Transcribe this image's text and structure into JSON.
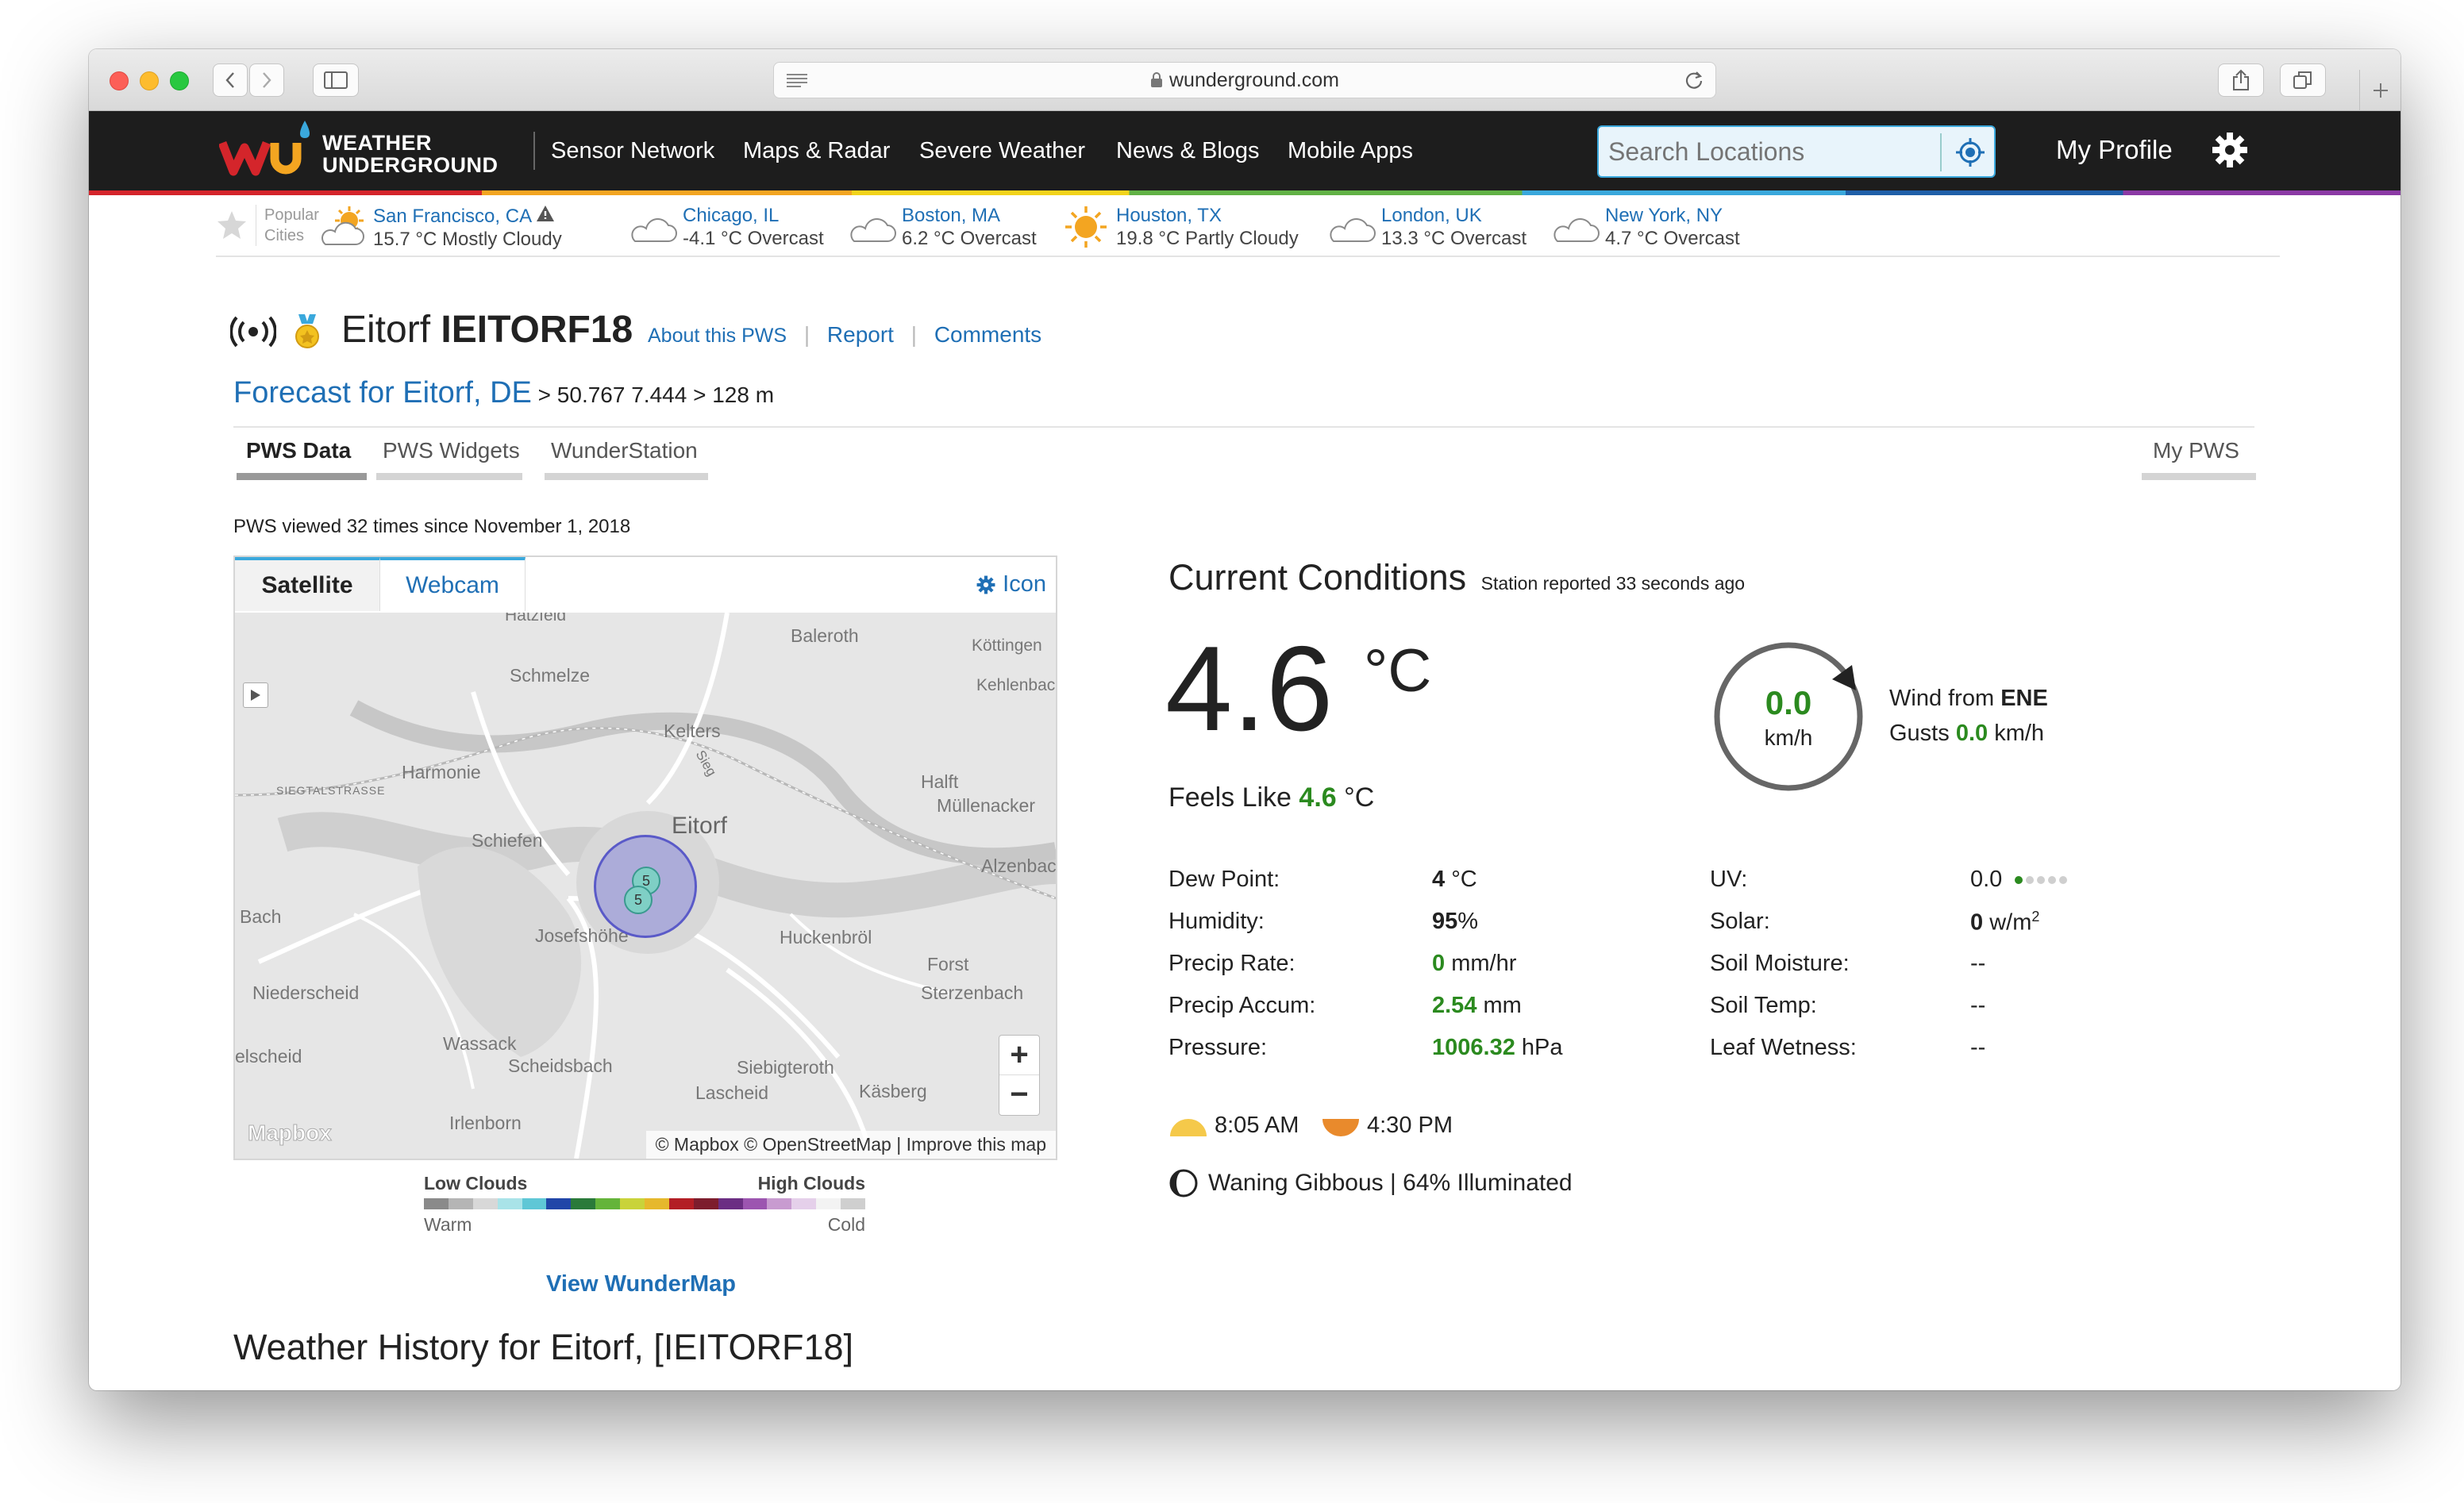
{
  "browser": {
    "url": "wunderground.com"
  },
  "site": {
    "logo_text_line1": "WEATHER",
    "logo_text_line2": "UNDERGROUND",
    "nav": [
      "Sensor Network",
      "Maps & Radar",
      "Severe Weather",
      "News & Blogs",
      "Mobile Apps"
    ],
    "search_placeholder": "Search Locations",
    "profile": "My Profile"
  },
  "popular_cities": {
    "label_line1": "Popular",
    "label_line2": "Cities",
    "items": [
      {
        "name": "San Francisco, CA",
        "weather": "15.7 °C Mostly Cloudy",
        "icon": "partly-cloudy-icon",
        "alert": true
      },
      {
        "name": "Chicago, IL",
        "weather": "-4.1 °C Overcast",
        "icon": "cloud-icon"
      },
      {
        "name": "Boston, MA",
        "weather": "6.2 °C Overcast",
        "icon": "cloud-icon"
      },
      {
        "name": "Houston, TX",
        "weather": "19.8 °C Partly Cloudy",
        "icon": "sun-icon"
      },
      {
        "name": "London, UK",
        "weather": "13.3 °C Overcast",
        "icon": "cloud-icon"
      },
      {
        "name": "New York, NY",
        "weather": "4.7 °C Overcast",
        "icon": "cloud-icon"
      }
    ]
  },
  "station": {
    "name": "Eitorf",
    "id": "IEITORF18",
    "links": [
      "About this PWS",
      "Report",
      "Comments"
    ],
    "forecast_link": "Forecast for Eitorf, DE",
    "coords": "> 50.767 7.444 > 128 m",
    "views": "PWS viewed 32 times since November 1, 2018"
  },
  "tabs": {
    "items": [
      "PWS Data",
      "PWS Widgets",
      "WunderStation"
    ],
    "active": "PWS Data",
    "right": "My PWS"
  },
  "map": {
    "tabs": [
      "Satellite",
      "Webcam"
    ],
    "icon_label": "Icon",
    "places": [
      "Hatzfeld",
      "Baleroth",
      "Köttingen",
      "Kehlenbach",
      "Schmelze",
      "Kelters",
      "Harmonie",
      "SIEGTALSTRASSE",
      "Halft",
      "Müllenacker",
      "Schiefen",
      "Eitorf",
      "Alzenbach",
      "Bach",
      "Josefshöhe",
      "Huckenbröl",
      "Forst",
      "Sterzenbach",
      "Niederscheid",
      "Wassack",
      "Scheidsbach",
      "Siebigteroth",
      "Lascheid",
      "Käsberg",
      "elscheid",
      "Irlenborn",
      "Sieg"
    ],
    "cluster_labels": [
      "5",
      "5"
    ],
    "attribution": "© Mapbox © OpenStreetMap | Improve this map",
    "brand": "Mapbox",
    "zoom_in": "+",
    "zoom_out": "−",
    "legend_top_left": "Low Clouds",
    "legend_top_right": "High Clouds",
    "legend_bottom_left": "Warm",
    "legend_bottom_right": "Cold",
    "legend_colors": [
      "#8a8a8a",
      "#b5b5b5",
      "#d8d8d8",
      "#a9e3e8",
      "#5fc7d6",
      "#2146a8",
      "#2a7a3a",
      "#64b43a",
      "#c9d33a",
      "#e6b82c",
      "#b31e25",
      "#7d1d2d",
      "#6b2e83",
      "#9c55b0",
      "#c89bd0",
      "#e5d0ea",
      "#f3f3f3",
      "#cfcfcf"
    ],
    "view_link": "View WunderMap"
  },
  "conditions": {
    "title": "Current Conditions",
    "reported": "Station reported 33 seconds ago",
    "temp": "4.6",
    "temp_unit": "°C",
    "feels_like_label": "Feels Like",
    "feels_like_value": "4.6",
    "feels_like_unit": "°C",
    "wind_speed": "0.0",
    "wind_unit": "km/h",
    "wind_from_label": "Wind from",
    "wind_from_dir": "ENE",
    "gusts_label": "Gusts",
    "gusts_value": "0.0",
    "gusts_unit": "km/h",
    "left_rows": [
      {
        "label": "Dew Point:",
        "value": "4",
        "unit": "°C"
      },
      {
        "label": "Humidity:",
        "value": "95",
        "unit": "%"
      },
      {
        "label": "Precip Rate:",
        "value": "0",
        "unit": "mm/hr"
      },
      {
        "label": "Precip Accum:",
        "value": "2.54",
        "unit": "mm"
      },
      {
        "label": "Pressure:",
        "value": "1006.32",
        "unit": "hPa"
      }
    ],
    "right_rows": [
      {
        "label": "UV:",
        "value": "0.0"
      },
      {
        "label": "Solar:",
        "value": "0",
        "unit": "w/m",
        "sup": "2"
      },
      {
        "label": "Soil Moisture:",
        "value": "--"
      },
      {
        "label": "Soil Temp:",
        "value": "--"
      },
      {
        "label": "Leaf Wetness:",
        "value": "--"
      }
    ],
    "uv_level": 1,
    "uv_scale": 5,
    "sunrise": "8:05 AM",
    "sunset": "4:30 PM",
    "moon": "Waning Gibbous | 64% Illuminated"
  },
  "history_title": "Weather History for Eitorf, [IEITORF18]",
  "colors": {
    "header_bg": "#1d1d1d",
    "link": "#1f6fb5",
    "value_green": "#2b8a1f"
  }
}
